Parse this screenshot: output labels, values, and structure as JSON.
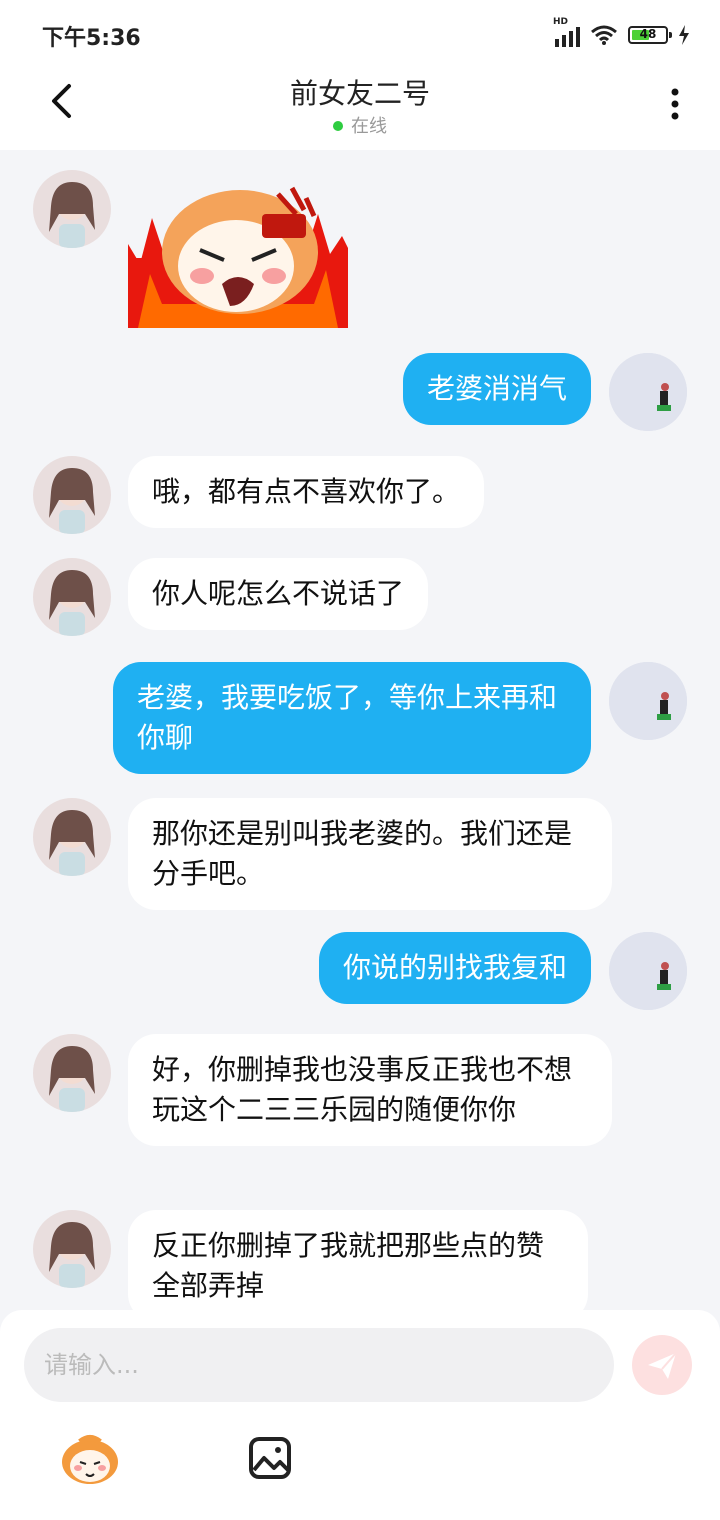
{
  "status_bar": {
    "time": "下午5:36",
    "network": "HD",
    "battery": "48"
  },
  "header": {
    "title": "前女友二号",
    "presence": "在线"
  },
  "messages": [
    {
      "side": "in",
      "type": "sticker"
    },
    {
      "side": "out",
      "text": "老婆消消气"
    },
    {
      "side": "in",
      "text": "哦，都有点不喜欢你了。"
    },
    {
      "side": "in",
      "text": "你人呢怎么不说话了"
    },
    {
      "side": "out",
      "text": "老婆，我要吃饭了，等你上来再和你聊"
    },
    {
      "side": "in",
      "text": "那你还是别叫我老婆的。我们还是分手吧。"
    },
    {
      "side": "out",
      "text": "你说的别找我复和"
    },
    {
      "side": "in",
      "text": "好，你删掉我也没事反正我也不想玩这个二三三乐园的随便你你"
    },
    {
      "side": "in",
      "text": "反正你删掉了我就把那些点的赞全部弄掉"
    }
  ],
  "composer": {
    "placeholder": "请输入..."
  },
  "colors": {
    "outgoing_bubble": "#1fb0f2",
    "incoming_bubble": "#ffffff",
    "online_dot": "#2ecc40"
  }
}
